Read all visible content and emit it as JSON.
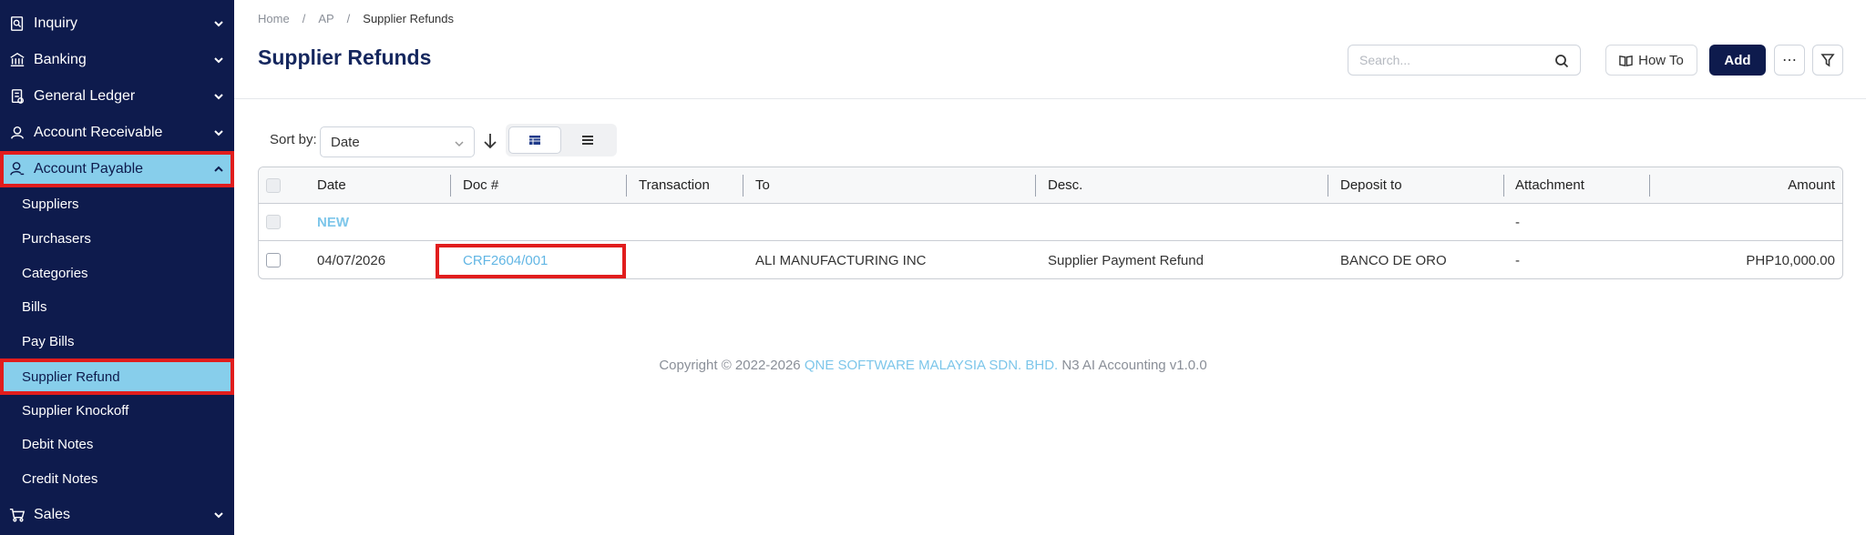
{
  "sidebar": {
    "groups": [
      {
        "label": "Inquiry",
        "icon": "inquiry-icon"
      },
      {
        "label": "Banking",
        "icon": "bank-icon"
      },
      {
        "label": "General Ledger",
        "icon": "ledger-icon"
      },
      {
        "label": "Account Receivable",
        "icon": "receivable-icon"
      },
      {
        "label": "Account Payable",
        "icon": "payable-icon",
        "active": true
      },
      {
        "label": "Sales",
        "icon": "cart-icon"
      }
    ],
    "sub_items": [
      {
        "label": "Suppliers"
      },
      {
        "label": "Purchasers"
      },
      {
        "label": "Categories"
      },
      {
        "label": "Bills"
      },
      {
        "label": "Pay Bills"
      },
      {
        "label": "Supplier Refund",
        "active": true
      },
      {
        "label": "Supplier Knockoff"
      },
      {
        "label": "Debit Notes"
      },
      {
        "label": "Credit Notes"
      }
    ]
  },
  "breadcrumb": [
    "Home",
    "AP",
    "Supplier Refunds"
  ],
  "page_title": "Supplier Refunds",
  "search": {
    "placeholder": "Search...",
    "value": ""
  },
  "toolbar": {
    "howto_label": "How To",
    "add_label": "Add",
    "more_label": "⋯"
  },
  "sort": {
    "label": "Sort by:",
    "selected": "Date"
  },
  "table": {
    "columns": [
      "Date",
      "Doc #",
      "Transaction",
      "To",
      "Desc.",
      "Deposit to",
      "Attachment",
      "Amount"
    ],
    "new_row": {
      "label": "NEW",
      "attachment": "-"
    },
    "rows": [
      {
        "date": "04/07/2026",
        "doc": "CRF2604/001",
        "transaction": "",
        "to": "ALI MANUFACTURING INC",
        "desc": "Supplier Payment Refund",
        "deposit_to": "BANCO DE ORO",
        "attachment": "-",
        "amount": "PHP10,000.00"
      }
    ]
  },
  "footer": {
    "prefix": "Copyright © 2022-2026",
    "company": "QNE SOFTWARE MALAYSIA SDN. BHD.",
    "suffix": "N3 AI Accounting v1.0.0"
  },
  "colors": {
    "sidebar_bg": "#0e1b4d",
    "active_bg": "#87ceeb",
    "highlight": "#e11d1d",
    "link": "#62b6e4",
    "title": "#15275e"
  }
}
